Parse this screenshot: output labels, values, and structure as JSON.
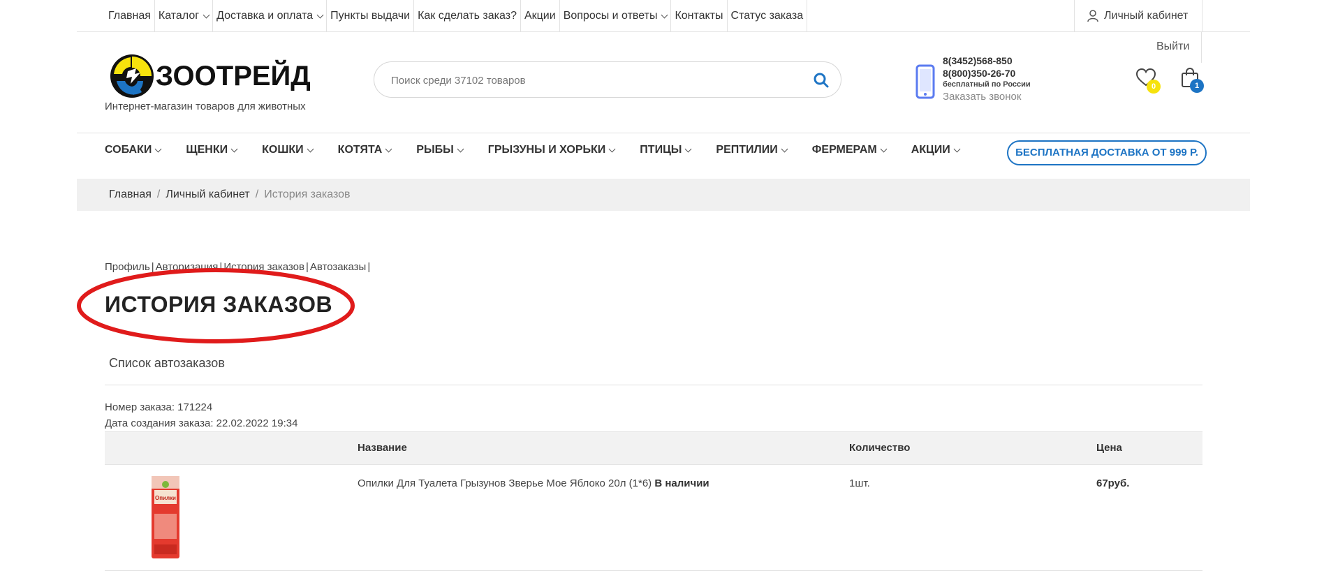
{
  "topbar": {
    "items": [
      {
        "label": "Главная",
        "dropdown": false
      },
      {
        "label": "Каталог",
        "dropdown": true
      },
      {
        "label": "Доставка и оплата",
        "dropdown": true
      },
      {
        "label": "Пункты выдачи",
        "dropdown": false
      },
      {
        "label": "Как сделать заказ?",
        "dropdown": false
      },
      {
        "label": "Акции",
        "dropdown": false
      },
      {
        "label": "Вопросы и ответы",
        "dropdown": true
      },
      {
        "label": "Контакты",
        "dropdown": false
      },
      {
        "label": "Статус заказа",
        "dropdown": false
      }
    ],
    "account_label": "Личный кабинет",
    "logout_label": "Выйти"
  },
  "header": {
    "logo_text": "ЗООТРЕЙД",
    "tagline": "Интернет-магазин товаров для животных",
    "search_placeholder": "Поиск среди 37102 товаров",
    "phone1": "8(3452)568-850",
    "phone2": "8(800)350-26-70",
    "phone2_note": "бесплатный по России",
    "callback": "Заказать звонок",
    "favorites_count": "0",
    "cart_count": "1"
  },
  "catnav": {
    "items": [
      "СОБАКИ",
      "ЩЕНКИ",
      "КОШКИ",
      "КОТЯТА",
      "РЫБЫ",
      "ГРЫЗУНЫ И ХОРЬКИ",
      "ПТИЦЫ",
      "РЕПТИЛИИ",
      "ФЕРМЕРАМ",
      "АКЦИИ"
    ],
    "free_delivery": "БЕСПЛАТНАЯ ДОСТАВКА ОТ 999 Р."
  },
  "breadcrumb": {
    "home": "Главная",
    "account": "Личный кабинет",
    "current": "История заказов"
  },
  "account_nav": {
    "items": [
      "Профиль",
      "Авторизация",
      "История заказов",
      "Автозаказы"
    ]
  },
  "page": {
    "title": "ИСТОРИЯ ЗАКАЗОВ",
    "autolist_link": "Список автозаказов",
    "highlight_color": "#e01b1b"
  },
  "order": {
    "number_label": "Номер заказа: 171224",
    "date_label": "Дата создания заказа: 22.02.2022 19:34",
    "columns": {
      "name": "Название",
      "qty": "Количество",
      "price": "Цена"
    },
    "items": [
      {
        "name": "Опилки Для Туалета Грызунов Зверье Мое Яблоко 20л (1*6)",
        "availability": "В наличии",
        "qty": "1шт.",
        "price": "67руб.",
        "image_text": "Опилки"
      }
    ]
  },
  "colors": {
    "accent_blue": "#1d74c4",
    "badge_yellow": "#f6e20d",
    "logo_yellow": "#f6e20d",
    "logo_blue": "#1d74c4"
  }
}
